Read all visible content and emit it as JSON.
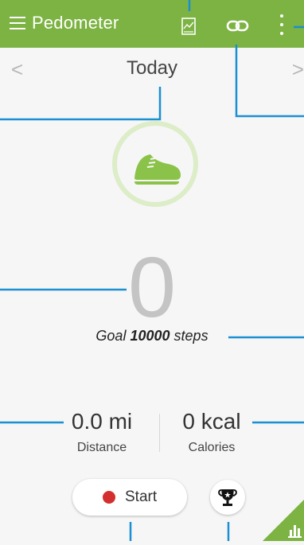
{
  "appbar": {
    "title": "Pedometer",
    "icons": [
      "menu-icon",
      "report-icon",
      "link-icon",
      "more-vert-icon"
    ],
    "color": "#7cb342"
  },
  "nav": {
    "date": "Today",
    "prev": "<",
    "next": ">"
  },
  "progress": {
    "icon": "sneaker-icon",
    "ring_color": "#dcedc8",
    "shoe_color": "#8bc34a"
  },
  "steps": {
    "count": "0"
  },
  "goal": {
    "prefix": "Goal",
    "value": "10000",
    "suffix": "steps"
  },
  "stats": {
    "distance": {
      "value": "0.0 mi",
      "label": "Distance"
    },
    "calories": {
      "value": "0 kcal",
      "label": "Calories"
    }
  },
  "actions": {
    "start_label": "Start",
    "start_dot_color": "#d32f2f",
    "trophy_icon": "trophy-icon",
    "corner_icon": "bar-chart-icon"
  },
  "callout_color": "#1a8fd2"
}
